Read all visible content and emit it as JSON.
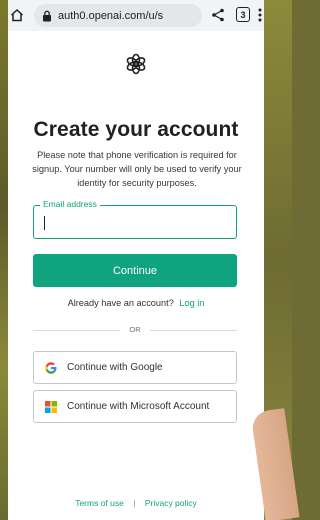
{
  "browser": {
    "url": "auth0.openai.com/u/s",
    "tab_count": "3"
  },
  "page": {
    "title": "Create your account",
    "subtitle": "Please note that phone verification is required for signup. Your number will only be used to verify your identity for security purposes.",
    "email_label": "Email address",
    "email_value": "",
    "continue_label": "Continue",
    "have_account_text": "Already have an account?",
    "login_label": "Log in",
    "or_text": "OR",
    "google_label": "Continue with Google",
    "microsoft_label": "Continue with Microsoft Account",
    "terms_label": "Terms of use",
    "footer_separator": "|",
    "privacy_label": "Privacy policy"
  },
  "colors": {
    "accent": "#10a37f",
    "text": "#202123",
    "border": "#c2c8d0"
  },
  "icons": [
    "home-icon",
    "lock-icon",
    "share-icon",
    "tabs-icon",
    "more-menu-icon",
    "openai-logo-icon",
    "google-icon",
    "microsoft-icon"
  ]
}
